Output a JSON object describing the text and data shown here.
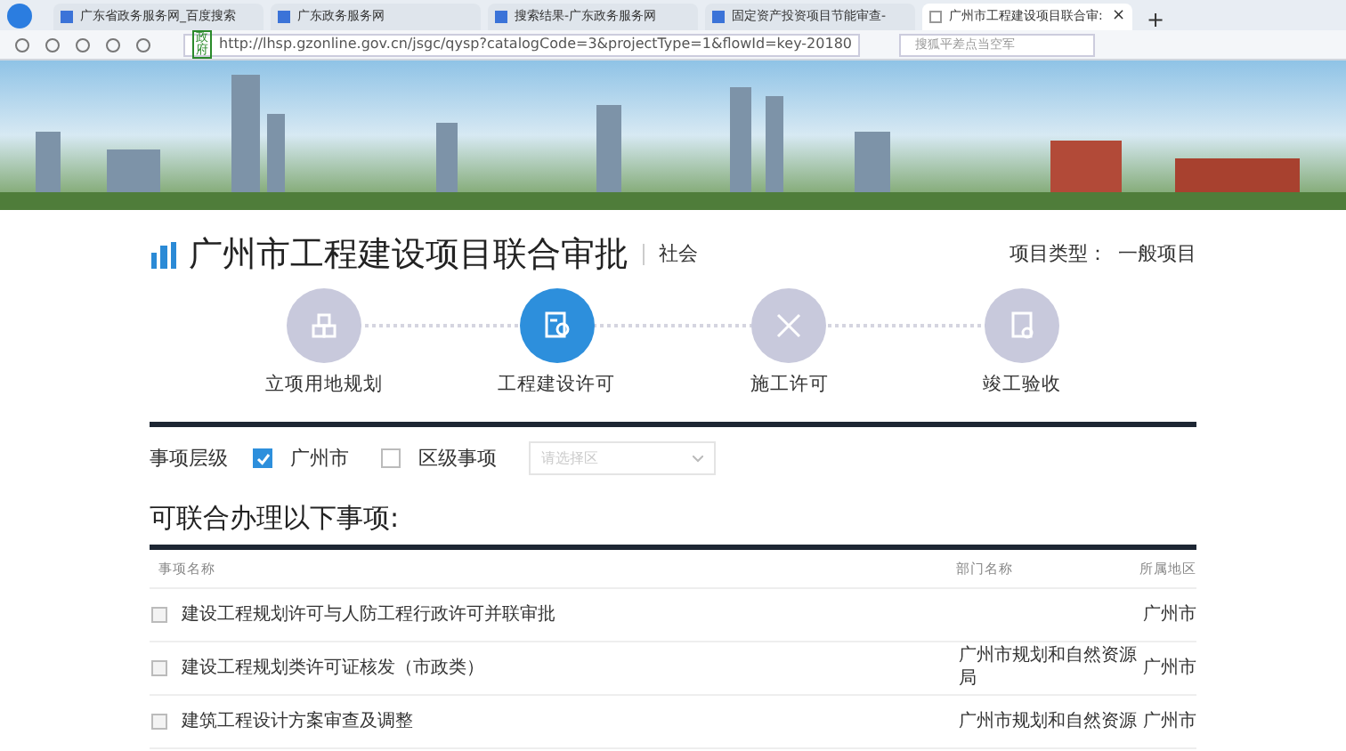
{
  "browser": {
    "tabs": [
      {
        "label": "广东省政务服务网_百度搜索",
        "selected": false
      },
      {
        "label": "广东政务服务网",
        "selected": false
      },
      {
        "label": "搜索结果-广东政务服务网",
        "selected": false
      },
      {
        "label": "固定资产投资项目节能审查-",
        "selected": false
      },
      {
        "label": "广州市工程建设项目联合审:",
        "selected": true
      }
    ],
    "close_tab": "×",
    "new_tab": "+",
    "address_badge": "政府",
    "url": "http://lhsp.gzonline.gov.cn/jsgc/qysp?catalogCode=3&projectType=1&flowId=key-20180",
    "search_placeholder": "搜狐平差点当空军"
  },
  "header": {
    "title": "广州市工程建设项目联合审批",
    "subtitle": "社会",
    "project_type_label": "项目类型：",
    "project_type_value": "一般项目"
  },
  "steps": [
    {
      "label": "立项用地规划",
      "kind": "cubes",
      "selected": false
    },
    {
      "label": "工程建设许可",
      "kind": "stamp",
      "selected": true
    },
    {
      "label": "施工许可",
      "kind": "tools",
      "selected": false
    },
    {
      "label": "竣工验收",
      "kind": "document",
      "selected": false
    }
  ],
  "filter": {
    "label": "事项层级",
    "options": [
      {
        "label": "广州市",
        "checked": true
      },
      {
        "label": "区级事项",
        "checked": false
      }
    ],
    "select_placeholder": "请选择区"
  },
  "section_title": "可联合办理以下事项:",
  "table": {
    "columns": [
      "事项名称",
      "部门名称",
      "所属地区"
    ],
    "rows": [
      {
        "name": "建设工程规划许可与人防工程行政许可并联审批",
        "department": "",
        "region": "广州市",
        "checked": false
      },
      {
        "name": "建设工程规划类许可证核发（市政类）",
        "department": "广州市规划和自然资源局",
        "region": "广州市",
        "checked": false
      },
      {
        "name": "建筑工程设计方案审查及调整",
        "department": "广州市规划和自然资源",
        "region": "广州市",
        "checked": false
      }
    ]
  }
}
